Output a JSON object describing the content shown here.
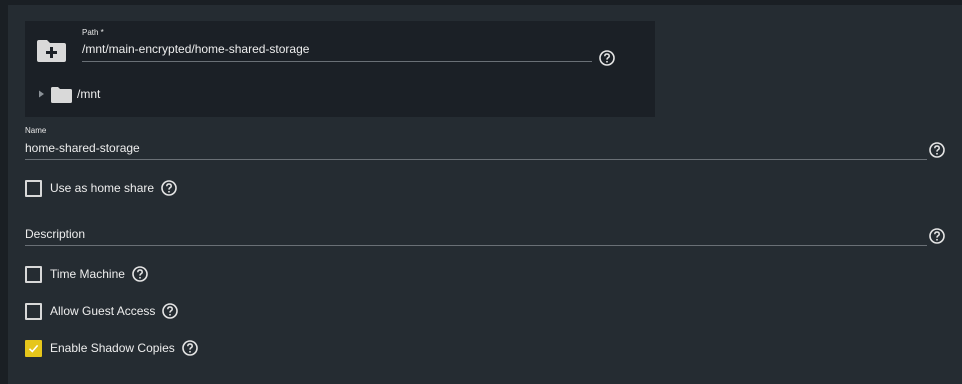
{
  "path_field": {
    "label": "Path *",
    "value": "/mnt/main-encrypted/home-shared-storage"
  },
  "tree": {
    "root_label": "/mnt"
  },
  "name_field": {
    "label": "Name",
    "value": "home-shared-storage"
  },
  "description_field": {
    "placeholder": "Description"
  },
  "checkboxes": {
    "home_share": {
      "label": "Use as home share",
      "checked": false
    },
    "time_machine": {
      "label": "Time Machine",
      "checked": false
    },
    "guest_access": {
      "label": "Allow Guest Access",
      "checked": false
    },
    "shadow_copies": {
      "label": "Enable Shadow Copies",
      "checked": true
    }
  },
  "colors": {
    "background": "#252c32",
    "explorer_background": "#1b2026",
    "accent_checked": "#e6c61b",
    "text": "#eeeeee"
  },
  "icons": {
    "folder_add": "folder-plus-icon",
    "help": "help-circle-icon",
    "expand": "triangle-right-icon",
    "folder": "folder-icon",
    "check": "check-icon"
  }
}
